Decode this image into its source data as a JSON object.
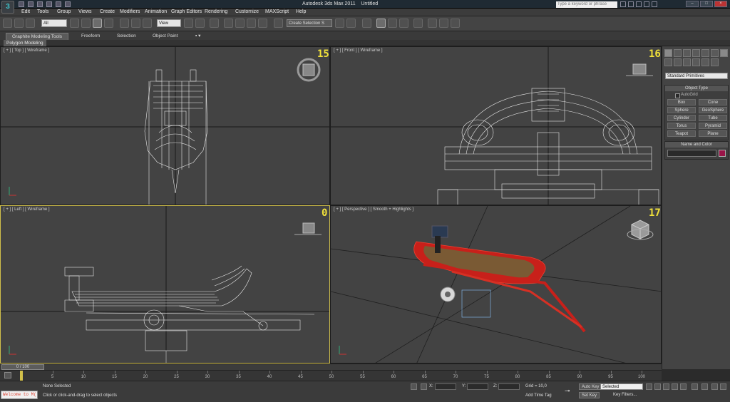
{
  "app": {
    "title": "Autodesk 3ds Max  2011",
    "file": "Untitled",
    "logo_text": "3",
    "search_placeholder": "Type a keyword or phrase"
  },
  "menu": [
    "Edit",
    "Tools",
    "Group",
    "Views",
    "Create",
    "Modifiers",
    "Animation",
    "Graph Editors",
    "Rendering",
    "Customize",
    "MAXScript",
    "Help"
  ],
  "toolbar": {
    "selection_filter": "All",
    "reference_coord": "View",
    "named_selection": "Create Selection S"
  },
  "ribbon": {
    "tabs": [
      "Graphite Modeling Tools",
      "Freeform",
      "Selection",
      "Object Paint"
    ],
    "active_tab": "Graphite Modeling Tools",
    "subtab": "Polygon Modeling"
  },
  "viewports": {
    "top": {
      "label": "[ + ] [ Top ] [ Wireframe ]",
      "number": "15"
    },
    "front": {
      "label": "[ + ] [ Front ] [ Wireframe ]",
      "number": "16"
    },
    "left": {
      "label": "[ + ] [ Left ] [ Wireframe ]",
      "number": "0"
    },
    "perspective": {
      "label": "[ + ] [ Perspective ] [ Smooth + Highlights ]",
      "number": "17"
    }
  },
  "command_panel": {
    "primitive_type": "Standard Primitives",
    "object_type_title": "Object Type",
    "autogrid_label": "AutoGrid",
    "object_buttons": [
      "Box",
      "Cone",
      "Sphere",
      "GeoSphere",
      "Cylinder",
      "Tube",
      "Torus",
      "Pyramid",
      "Teapot",
      "Plane"
    ],
    "name_color_title": "Name and Color",
    "object_color": "#9a1448"
  },
  "timeline": {
    "frame_display": "0 / 100",
    "ticks": [
      5,
      10,
      15,
      20,
      25,
      30,
      35,
      40,
      45,
      50,
      55,
      60,
      65,
      70,
      75,
      80,
      85,
      90,
      95,
      100
    ]
  },
  "status": {
    "welcome": "Welcome to M(",
    "selection": "None Selected",
    "prompt": "Click or click-and-drag to select objects",
    "x_label": "X:",
    "y_label": "Y:",
    "z_label": "Z:",
    "grid": "Grid = 10,0",
    "add_time_tag": "Add Time Tag",
    "auto_key": "Auto Key",
    "set_key": "Set Key",
    "key_mode": "Selected",
    "key_filters": "Key Filters..."
  }
}
